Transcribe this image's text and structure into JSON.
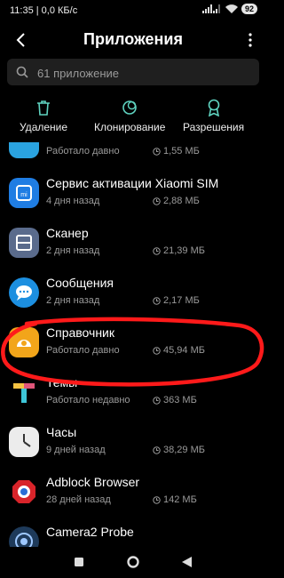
{
  "status_bar": {
    "time_speed": "11:35 | 0,0 КБ/с",
    "battery": "92"
  },
  "header": {
    "title": "Приложения"
  },
  "search": {
    "placeholder": "61 приложение"
  },
  "actions": [
    {
      "label": "Удаление",
      "icon": "trash-icon"
    },
    {
      "label": "Клонирование",
      "icon": "clone-icon"
    },
    {
      "label": "Разрешения",
      "icon": "permissions-icon"
    }
  ],
  "apps": [
    {
      "name": "",
      "status": "Работало давно",
      "size": "1,55 МБ",
      "icon": "app-icon-partial"
    },
    {
      "name": "Сервис активации Xiaomi SIM",
      "status": "4 дня назад",
      "size": "2,88 МБ",
      "icon": "mi-sim-icon"
    },
    {
      "name": "Сканер",
      "status": "2 дня назад",
      "size": "21,39 МБ",
      "icon": "scanner-icon"
    },
    {
      "name": "Сообщения",
      "status": "2 дня назад",
      "size": "2,17 МБ",
      "icon": "messages-icon"
    },
    {
      "name": "Справочник",
      "status": "Работало давно",
      "size": "45,94 МБ",
      "icon": "directory-icon"
    },
    {
      "name": "Темы",
      "status": "Работало недавно",
      "size": "363 МБ",
      "icon": "themes-icon"
    },
    {
      "name": "Часы",
      "status": "9 дней назад",
      "size": "38,29 МБ",
      "icon": "clock-icon"
    },
    {
      "name": "Adblock Browser",
      "status": "28 дней назад",
      "size": "142 МБ",
      "icon": "adblock-icon"
    },
    {
      "name": "Camera2 Probe",
      "status": "",
      "size": "",
      "icon": "camera-probe-icon"
    }
  ],
  "colors": {
    "accent": "#5fd3c0",
    "annotation": "#ff1a1a",
    "muted": "#9a9a9a"
  }
}
